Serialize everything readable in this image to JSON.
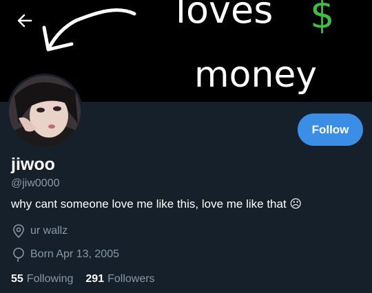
{
  "banner": {
    "line1": "loves",
    "dollar": "$",
    "line2": "money"
  },
  "profile": {
    "name": "jiwoo",
    "handle": "@jiw0000",
    "bio": "why cant someone love me like this, love me like that ☹",
    "location": "ur wallz",
    "born": "Born Apr 13, 2005"
  },
  "actions": {
    "follow_label": "Follow"
  },
  "stats": {
    "following_count": "55",
    "following_label": "Following",
    "followers_count": "291",
    "followers_label": "Followers"
  },
  "colors": {
    "background": "#15202b",
    "accent": "#3a8ee6",
    "muted": "#8899a6",
    "dollar": "#3fbf3f"
  },
  "icons": {
    "back": "arrow-left-icon",
    "location": "location-pin-icon",
    "born": "balloon-icon"
  }
}
